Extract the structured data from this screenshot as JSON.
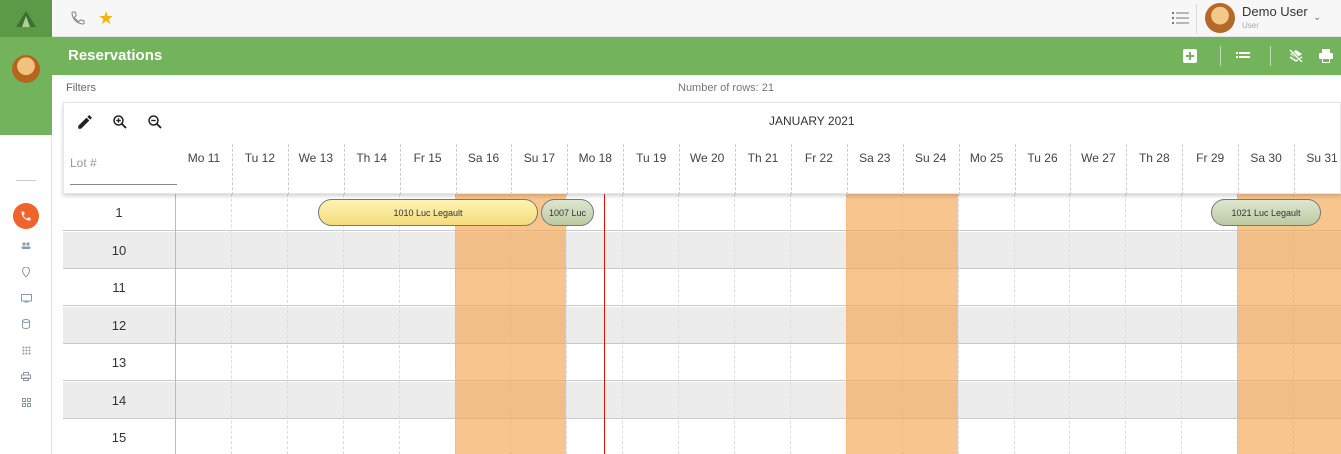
{
  "topbar": {
    "user_name": "Demo User",
    "user_role": "User"
  },
  "header": {
    "title": "Reservations"
  },
  "filters": {
    "label": "Filters",
    "rows_count": "Number of rows: 21"
  },
  "scheduler": {
    "month": "JANUARY 2021",
    "lot_label": "Lot #",
    "days": [
      "Mo 11",
      "Tu 12",
      "We 13",
      "Th 14",
      "Fr 15",
      "Sa 16",
      "Su 17",
      "Mo 18",
      "Tu 19",
      "We 20",
      "Th 21",
      "Fr 22",
      "Sa 23",
      "Su 24",
      "Mo 25",
      "Tu 26",
      "We 27",
      "Th 28",
      "Fr 29",
      "Sa 30",
      "Su 31"
    ],
    "rows": [
      "1",
      "10",
      "11",
      "12",
      "13",
      "14",
      "15"
    ],
    "reservations": [
      {
        "label": "1010 Luc Legault",
        "color": "yellow"
      },
      {
        "label": "1007 Luc",
        "color": "green"
      },
      {
        "label": "1021 Luc Legault",
        "color": "green"
      }
    ]
  },
  "colors": {
    "brand_green": "#72b35c",
    "weekend": "#f4a651",
    "today_line": "#dd1111",
    "phone_badge": "#f0632b"
  }
}
